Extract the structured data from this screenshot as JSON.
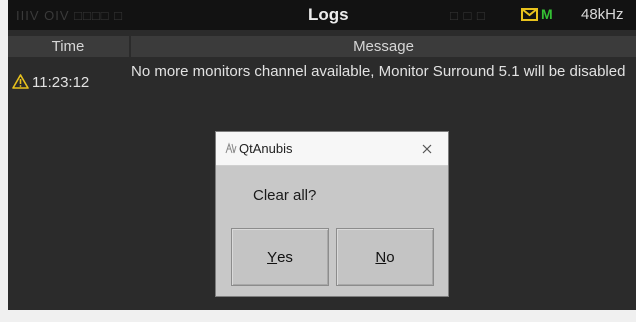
{
  "window": {
    "title": "Logs"
  },
  "status_bar": {
    "left_dim": "IIIV  OIV   □□□□  □",
    "right_dim": "□ □  □",
    "indicator": "M",
    "sample_rate": "48kHz",
    "mail_icon": "envelope-icon",
    "colors": {
      "accent_yellow": "#e8c21d",
      "indicator_green": "#34c034"
    }
  },
  "log_table": {
    "columns": [
      "Time",
      "Message"
    ],
    "rows": [
      {
        "level_icon": "warning-icon",
        "time": "11:23:12",
        "message": "No more monitors channel available, Monitor  Surround 5.1 will be disabled"
      }
    ]
  },
  "dialog": {
    "app_name": "QtAnubis",
    "text": "Clear all?",
    "yes": {
      "mnemonic": "Y",
      "rest": "es"
    },
    "no": {
      "mnemonic": "N",
      "rest": "o"
    }
  }
}
